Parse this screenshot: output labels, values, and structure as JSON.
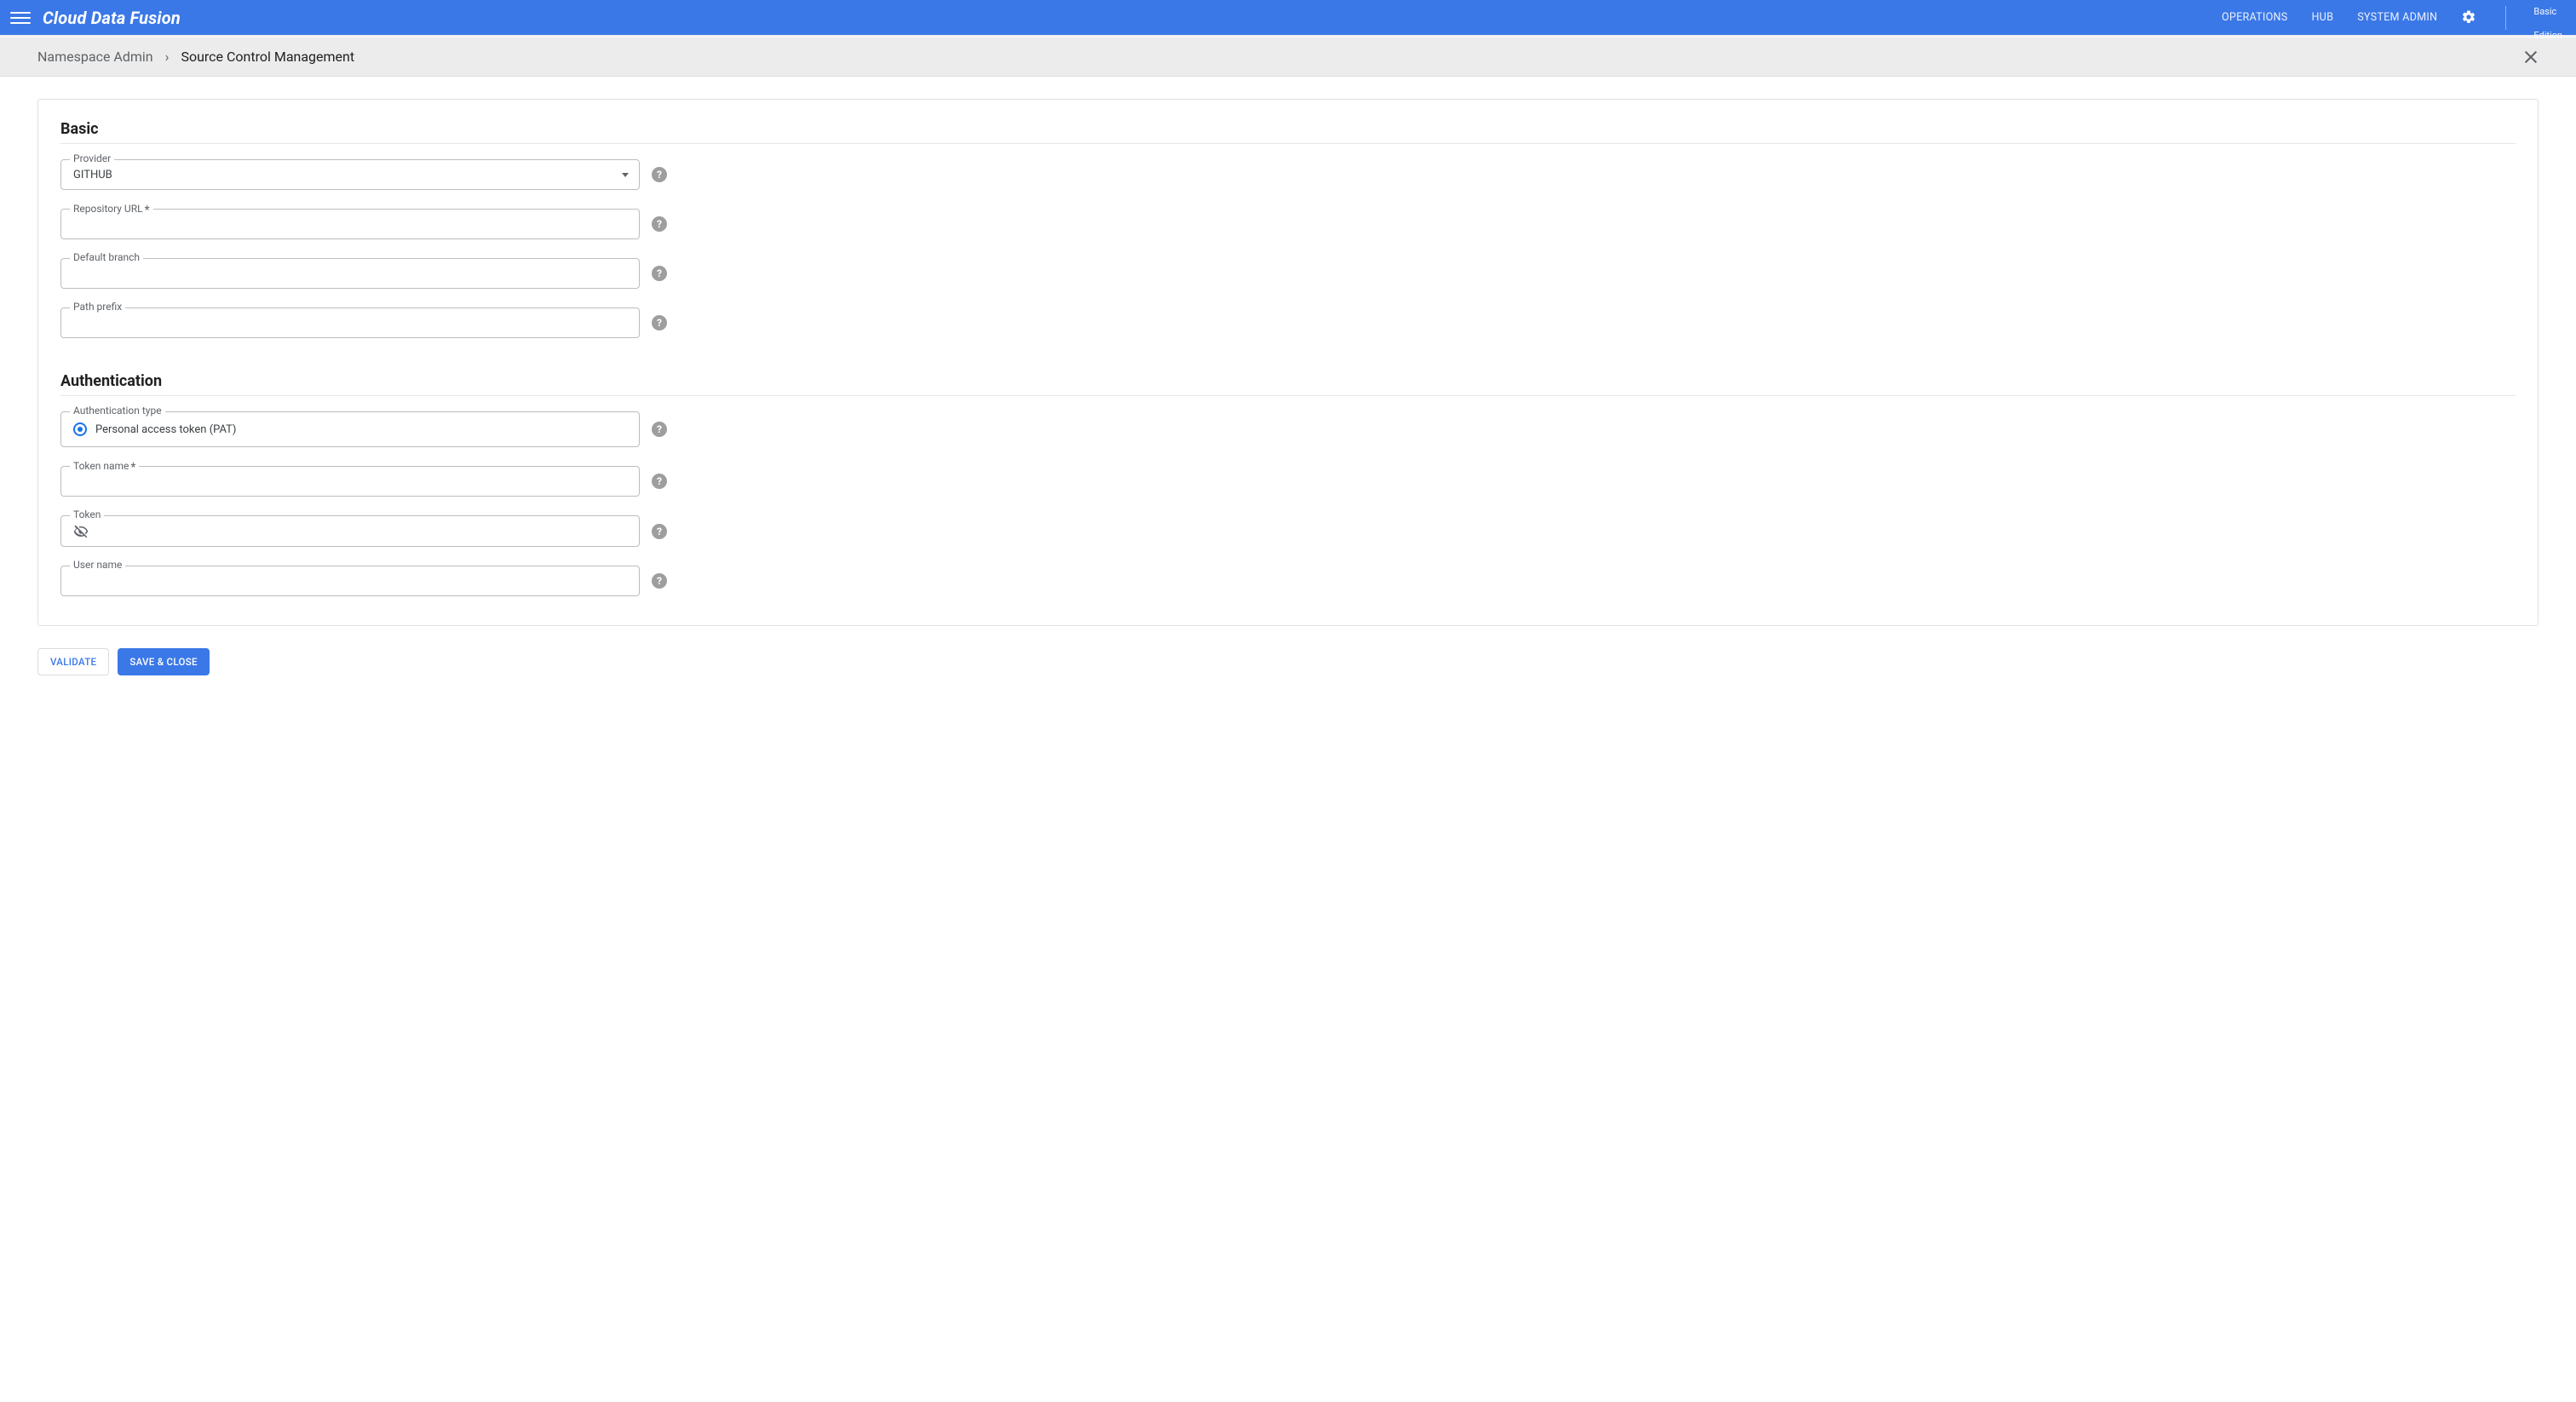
{
  "header": {
    "app_title": "Cloud Data Fusion",
    "links": {
      "operations": "OPERATIONS",
      "hub": "HUB",
      "system_admin": "SYSTEM ADMIN"
    },
    "edition_line1": "Basic",
    "edition_line2": "Edition"
  },
  "breadcrumb": {
    "item0": "Namespace Admin",
    "item1": "Source Control Management"
  },
  "sections": {
    "basic_title": "Basic",
    "auth_title": "Authentication"
  },
  "fields": {
    "provider": {
      "label": "Provider",
      "value": "GITHUB"
    },
    "repo_url": {
      "label": "Repository URL",
      "required_mark": "*",
      "value": ""
    },
    "default_branch": {
      "label": "Default branch",
      "value": ""
    },
    "path_prefix": {
      "label": "Path prefix",
      "value": ""
    },
    "auth_type": {
      "label": "Authentication type",
      "option_pat": "Personal access token (PAT)"
    },
    "token_name": {
      "label": "Token name",
      "required_mark": "*",
      "value": ""
    },
    "token": {
      "label": "Token",
      "value": ""
    },
    "user_name": {
      "label": "User name",
      "value": ""
    }
  },
  "buttons": {
    "validate": "VALIDATE",
    "save_close": "SAVE & CLOSE"
  },
  "glyphs": {
    "help": "?"
  }
}
